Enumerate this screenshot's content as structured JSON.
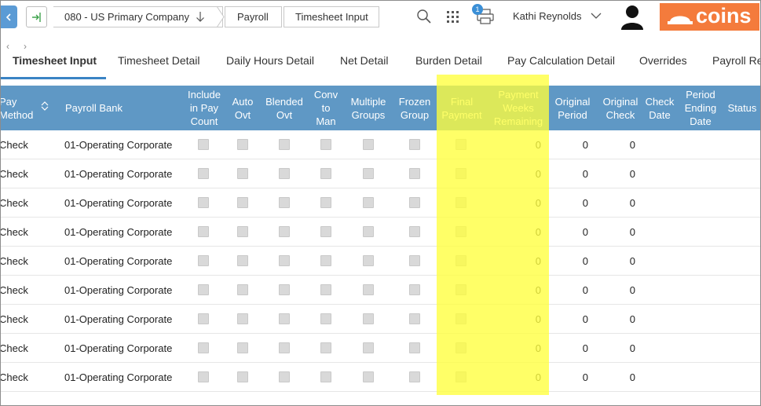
{
  "header": {
    "company": "080 - US Primary Company",
    "breadcrumb_payroll": "Payroll",
    "breadcrumb_timesheet": "Timesheet Input",
    "notification_count": "1",
    "user_name": "Kathi Reynolds",
    "logo_text": "coins",
    "icons": [
      "back-icon",
      "home-icon",
      "search-icon",
      "apps-grid-icon",
      "print-icon",
      "user-avatar-icon"
    ]
  },
  "tabs": [
    {
      "label": "Timesheet Input",
      "active": true
    },
    {
      "label": "Timesheet Detail"
    },
    {
      "label": "Daily Hours Detail"
    },
    {
      "label": "Net Detail"
    },
    {
      "label": "Burden Detail"
    },
    {
      "label": "Pay Calculation Detail"
    },
    {
      "label": "Overrides"
    },
    {
      "label": "Payroll Re"
    }
  ],
  "table": {
    "headers": {
      "pay_method": "Pay Method",
      "payroll_bank": "Payroll Bank",
      "include_pay_count": "Include in Pay Count",
      "auto_ovt": "Auto Ovt",
      "blended_ovt": "Blended Ovt",
      "conv_to_man": "Conv to Man",
      "multiple_groups": "Multiple Groups",
      "frozen_group": "Frozen Group",
      "final_payment": "Final Payment",
      "payment_weeks_remaining": "Payment Weeks Remaining",
      "original_period": "Original Period",
      "original_check": "Original Check",
      "check_date": "Check Date",
      "period_ending_date": "Period Ending Date",
      "status": "Status"
    },
    "rows": [
      {
        "pay_method": "Check",
        "payroll_bank": "01-Operating Corporate",
        "weeks_remaining": "0",
        "original_period": "0",
        "original_check": "0"
      },
      {
        "pay_method": "Check",
        "payroll_bank": "01-Operating Corporate",
        "weeks_remaining": "0",
        "original_period": "0",
        "original_check": "0"
      },
      {
        "pay_method": "Check",
        "payroll_bank": "01-Operating Corporate",
        "weeks_remaining": "0",
        "original_period": "0",
        "original_check": "0"
      },
      {
        "pay_method": "Check",
        "payroll_bank": "01-Operating Corporate",
        "weeks_remaining": "0",
        "original_period": "0",
        "original_check": "0"
      },
      {
        "pay_method": "Check",
        "payroll_bank": "01-Operating Corporate",
        "weeks_remaining": "0",
        "original_period": "0",
        "original_check": "0"
      },
      {
        "pay_method": "Check",
        "payroll_bank": "01-Operating Corporate",
        "weeks_remaining": "0",
        "original_period": "0",
        "original_check": "0"
      },
      {
        "pay_method": "Check",
        "payroll_bank": "01-Operating Corporate",
        "weeks_remaining": "0",
        "original_period": "0",
        "original_check": "0"
      },
      {
        "pay_method": "Check",
        "payroll_bank": "01-Operating Corporate",
        "weeks_remaining": "0",
        "original_period": "0",
        "original_check": "0"
      },
      {
        "pay_method": "Check",
        "payroll_bank": "01-Operating Corporate",
        "weeks_remaining": "0",
        "original_period": "0",
        "original_check": "0"
      }
    ]
  },
  "colors": {
    "header_bg": "#5f98c5",
    "accent": "#3a83c4",
    "logo_bg": "#f47b3c",
    "highlight": "#ffff3c"
  }
}
